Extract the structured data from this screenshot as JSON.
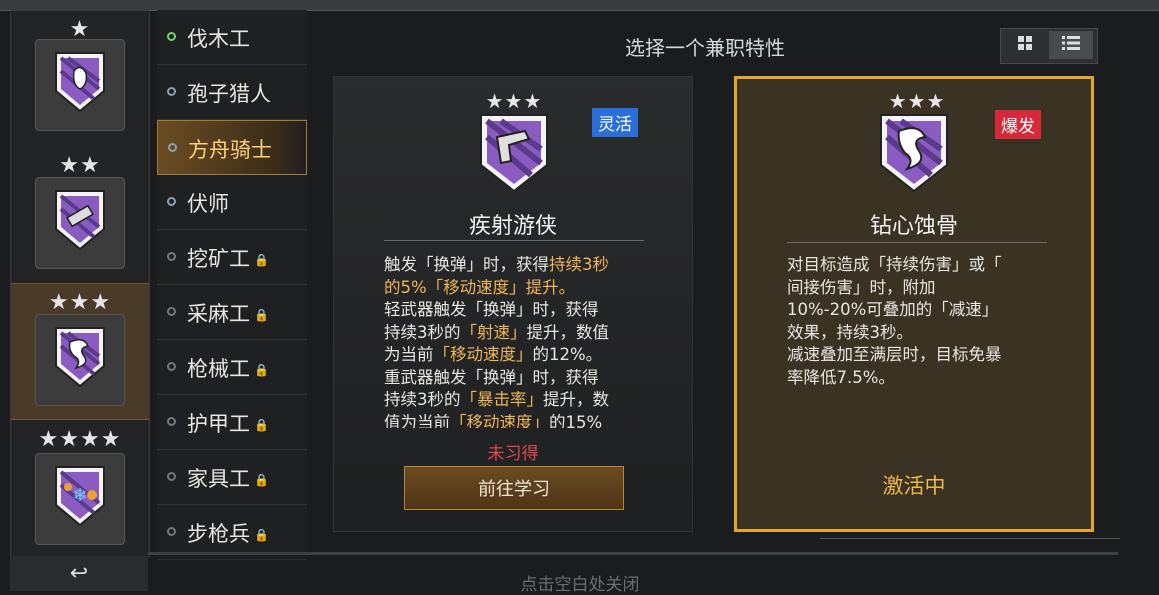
{
  "header": {
    "title": "选择一个兼职特性"
  },
  "badges": [
    {
      "stars": "★",
      "selected": false
    },
    {
      "stars": "★★",
      "selected": false
    },
    {
      "stars": "★★★",
      "selected": true
    },
    {
      "stars": "★★★★",
      "selected": false
    }
  ],
  "nav": [
    {
      "label": "伐木工",
      "locked": false,
      "dot": "green"
    },
    {
      "label": "孢子猎人",
      "locked": false,
      "dot": "blue"
    },
    {
      "label": "方舟骑士",
      "locked": false,
      "dot": "blue",
      "active": true
    },
    {
      "label": "伏师",
      "locked": false,
      "dot": "blue"
    },
    {
      "label": "挖矿工",
      "locked": true,
      "dot": "grey"
    },
    {
      "label": "采麻工",
      "locked": true,
      "dot": "grey"
    },
    {
      "label": "枪械工",
      "locked": true,
      "dot": "grey"
    },
    {
      "label": "护甲工",
      "locked": true,
      "dot": "grey"
    },
    {
      "label": "家具工",
      "locked": true,
      "dot": "grey"
    },
    {
      "label": "步枪兵",
      "locked": true,
      "dot": "grey"
    }
  ],
  "lock_icon": "🔒",
  "cards": {
    "left": {
      "stars": "★★★",
      "tag": "灵活",
      "name": "疾射游侠",
      "desc": [
        [
          "触发「换弹」时，获得",
          "持续3秒",
          ""
        ],
        [
          "",
          "的5%「移动速度」提升。",
          ""
        ],
        [
          "轻武器触发「换弹」时，获得",
          "",
          ""
        ],
        [
          "持续3秒的",
          "「射速」",
          "提升，数值"
        ],
        [
          "为当前",
          "「移动速度」",
          "的12%。"
        ],
        [
          "重武器触发「换弹」时，获得",
          "",
          ""
        ],
        [
          "持续3秒的",
          "「暴击率」",
          "提升，数"
        ],
        [
          "值为当前",
          "「移动速度」",
          "的15%"
        ]
      ],
      "status": "未习得",
      "button": "前往学习"
    },
    "right": {
      "stars": "★★★",
      "tag": "爆发",
      "name": "钻心蚀骨",
      "desc": [
        "对目标造成「持续伤害」或「",
        "间接伤害」时，附加",
        "10%-20%可叠加的「减速」",
        "效果，持续3秒。",
        "减速叠加至满层时，目标免暴",
        "率降低7.5%。"
      ],
      "status": "激活中"
    }
  },
  "footer": {
    "back_icon": "↩",
    "close_hint": "点击空白处关闭"
  },
  "colors": {
    "accent_gold": "#e8a52e",
    "highlight": "#f0b654",
    "tag_blue": "#2a6ed8",
    "tag_red": "#d62a3c",
    "purple": "#8a5cc2"
  }
}
